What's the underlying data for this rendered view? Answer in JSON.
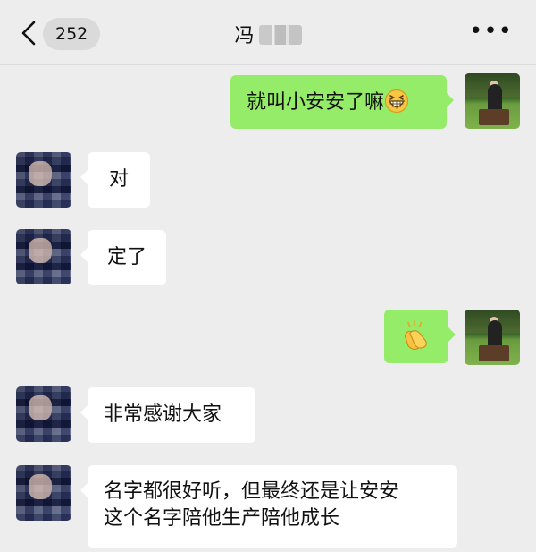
{
  "header": {
    "back_icon": "chevron-left-icon",
    "unread_count": "252",
    "title": "冯",
    "more_icon": "more-dots-icon",
    "more_label": "•••"
  },
  "messages": [
    {
      "sender": "me",
      "text": "就叫小安安了嘛",
      "emoji": "grinning-squinting-face"
    },
    {
      "sender": "other",
      "text": "对"
    },
    {
      "sender": "other",
      "text": "定了"
    },
    {
      "sender": "me",
      "emoji": "clapping-hands"
    },
    {
      "sender": "other",
      "text": "非常感谢大家"
    },
    {
      "sender": "other",
      "text_line1": "名字都很好听，但最终还是让安安",
      "text_line2": "这个名字陪他生产陪他成长"
    }
  ],
  "colors": {
    "background": "#ededed",
    "outgoing_bubble": "#95ec69",
    "incoming_bubble": "#ffffff",
    "badge": "#dadada"
  }
}
